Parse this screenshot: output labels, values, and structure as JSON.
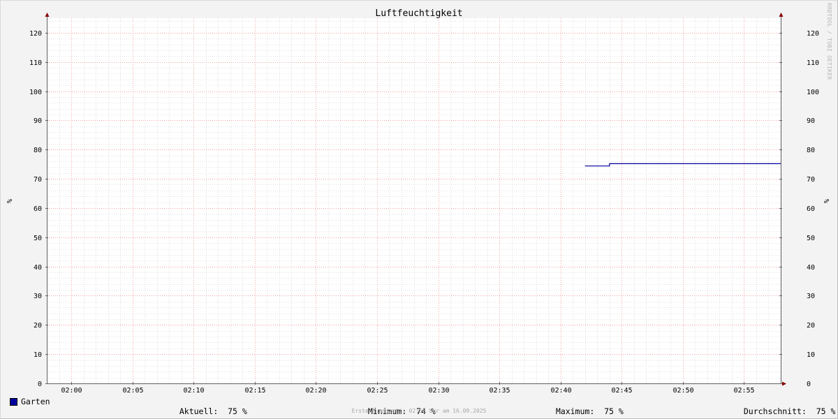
{
  "chart_data": {
    "type": "line",
    "title": "Luftfeuchtigkeit",
    "ylabel_left": "%",
    "ylabel_right": "%",
    "ylim": [
      0,
      125
    ],
    "yticks": [
      0,
      10,
      20,
      30,
      40,
      50,
      60,
      70,
      80,
      90,
      100,
      110,
      120
    ],
    "xlim": [
      "01:58",
      "02:58"
    ],
    "xticks": [
      "02:00",
      "02:05",
      "02:10",
      "02:15",
      "02:20",
      "02:25",
      "02:30",
      "02:35",
      "02:40",
      "02:45",
      "02:50",
      "02:55"
    ],
    "grid": true,
    "series": [
      {
        "name": "Garten",
        "color": "#0000a0",
        "points": [
          {
            "x": "02:42",
            "y": 74.4
          },
          {
            "x": "02:44",
            "y": 74.4
          },
          {
            "x": "02:44",
            "y": 75.2
          },
          {
            "x": "02:58",
            "y": 75.2
          }
        ]
      }
    ]
  },
  "legend": {
    "series_name": "Garten",
    "stats": [
      {
        "label": "Aktuell:",
        "value": "75 %"
      },
      {
        "label": "Minimum:",
        "value": "74 %"
      },
      {
        "label": "Maximum:",
        "value": "75 %"
      },
      {
        "label": "Durchschnitt:",
        "value": "75 %"
      }
    ]
  },
  "footer": "Erstellungszeit: 02:58 Uhr am 16.09.2025",
  "watermark": "RRDTOOL / TOBI OETIKER"
}
